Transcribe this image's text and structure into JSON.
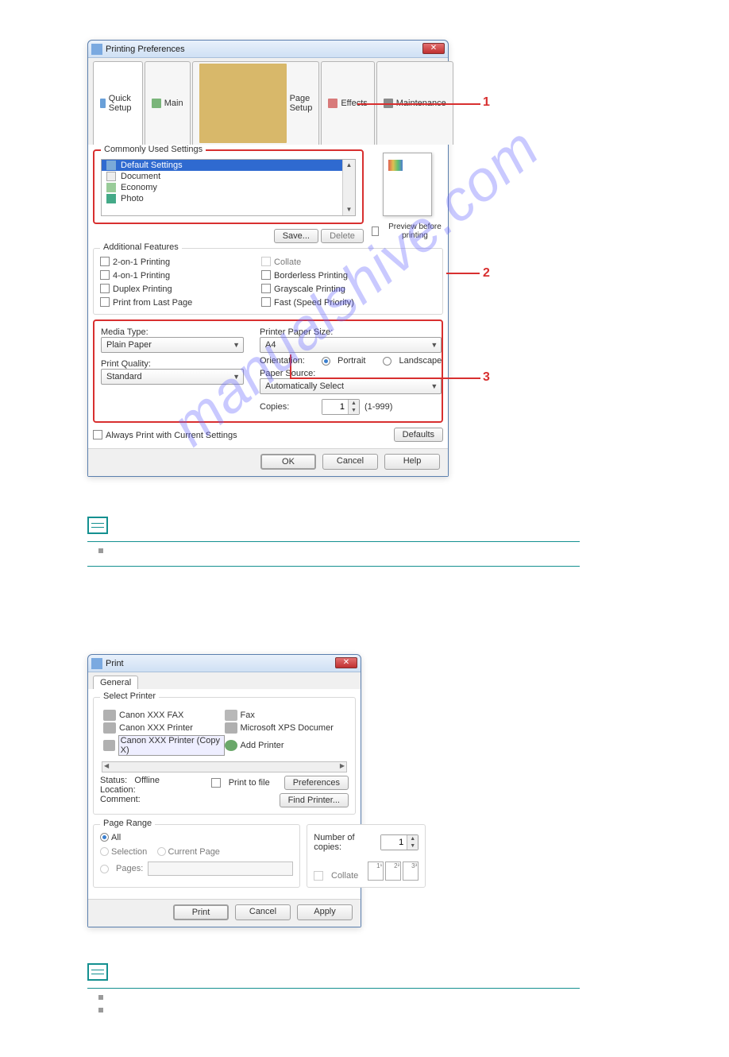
{
  "prefs": {
    "title": "Printing Preferences",
    "tabs": [
      "Quick Setup",
      "Main",
      "Page Setup",
      "Effects",
      "Maintenance"
    ],
    "commonly_used": {
      "legend": "Commonly Used Settings",
      "items": [
        "Default Settings",
        "Document",
        "Economy",
        "Photo"
      ],
      "save": "Save...",
      "delete": "Delete"
    },
    "preview_label": "Preview before printing",
    "additional": {
      "legend": "Additional Features",
      "left": [
        "2-on-1 Printing",
        "4-on-1 Printing",
        "Duplex Printing",
        "Print from Last Page"
      ],
      "right": [
        "Collate",
        "Borderless Printing",
        "Grayscale Printing",
        "Fast (Speed Priority)"
      ]
    },
    "media": {
      "media_label": "Media Type:",
      "media_value": "Plain Paper",
      "quality_label": "Print Quality:",
      "quality_value": "Standard",
      "size_label": "Printer Paper Size:",
      "size_value": "A4",
      "orientation_label": "Orientation:",
      "orientation_portrait": "Portrait",
      "orientation_landscape": "Landscape",
      "source_label": "Paper Source:",
      "source_value": "Automatically Select",
      "copies_label": "Copies:",
      "copies_value": "1",
      "copies_range": "(1-999)"
    },
    "always_print": "Always Print with Current Settings",
    "defaults": "Defaults",
    "ok": "OK",
    "cancel": "Cancel",
    "help": "Help"
  },
  "callouts": {
    "one": "1",
    "two": "2",
    "three": "3"
  },
  "print": {
    "title": "Print",
    "tab": "General",
    "select_printer_legend": "Select Printer",
    "printers": [
      "Canon XXX FAX",
      "Fax",
      "Canon XXX Printer",
      "Microsoft XPS Documer",
      "Canon XXX Printer (Copy X)",
      "Add Printer"
    ],
    "status_label": "Status:",
    "status_value": "Offline",
    "location_label": "Location:",
    "comment_label": "Comment:",
    "print_to_file": "Print to file",
    "preferences": "Preferences",
    "find_printer": "Find Printer...",
    "page_range_legend": "Page Range",
    "all": "All",
    "selection": "Selection",
    "current": "Current Page",
    "pages": "Pages:",
    "num_copies_label": "Number of copies:",
    "num_copies_value": "1",
    "collate": "Collate",
    "collate_pages": [
      "1¹",
      "2²",
      "3³"
    ],
    "print_btn": "Print",
    "cancel": "Cancel",
    "apply": "Apply"
  },
  "watermark": "manualshive.com"
}
